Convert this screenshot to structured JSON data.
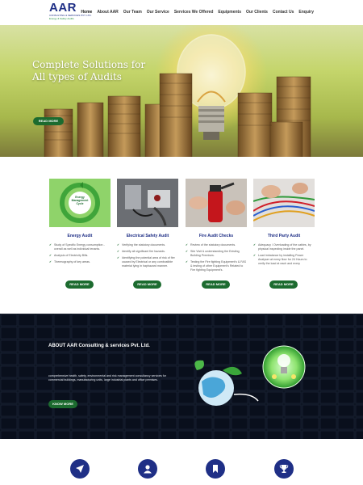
{
  "header": {
    "logo": {
      "name": "AAR",
      "subtitle": "CONSULTING & SERVICES PVT. LTD.",
      "tagline": "Energy & Safety Audits"
    },
    "nav": [
      "Home",
      "About AAR",
      "Our Team",
      "Our Service",
      "Services We Offered",
      "Equipments",
      "Our Clients",
      "Contact Us",
      "Enquiry"
    ]
  },
  "hero": {
    "title": "Complete Solutions for All types of Audits",
    "button": "READ MORE",
    "slide_indicator": "1"
  },
  "services": [
    {
      "title": "Energy Audit",
      "image_label": "Energy Management Cycle",
      "points": [
        "Study of Specific Energy consumption - overall as well as individual tenants.",
        "Analysis of Electricity Bills.",
        "Thermography of key areas."
      ],
      "button": "READ MORE"
    },
    {
      "title": "Electrical Safety Audit",
      "points": [
        "Verifying the statutory documents.",
        "Identify all significant fire hazards.",
        "Identifying the potential area of risk of fire caused by Electrical or any combustible material lying in haphazard manner."
      ],
      "button": "READ MORE"
    },
    {
      "title": "Fire Audit Checks",
      "points": [
        "Review of the statutory documents.",
        "Site Visit & understanding the Existing Building Premises.",
        "Testing the Fire fighting Equipment's & FAS & testing of other Equipment's Related to Fire fighting Equipment's."
      ],
      "button": "READ MORE"
    },
    {
      "title": "Third Party Audit",
      "points": [
        "Adequacy / Overloading of the cables, by physical inspecting inside the panel.",
        "Load imbalance by installing Power Analyser at every floor for 24 Hours to verify the load at each and every"
      ],
      "button": "READ MORE"
    }
  ],
  "about": {
    "title": "ABOUT AAR Consulting & services Pvt. Ltd.",
    "text": "comprehensive health, safety, environmental and risk management consultancy services for commercial buildings, manufacturing units, large industrial plants and office premises.",
    "button": "KNOW MORE"
  },
  "bottom_icons": [
    "location-arrow-icon",
    "user-icon",
    "bookmark-icon",
    "trophy-icon"
  ],
  "colors": {
    "brand_blue": "#1f2f86",
    "brand_green": "#1c6b2f"
  }
}
